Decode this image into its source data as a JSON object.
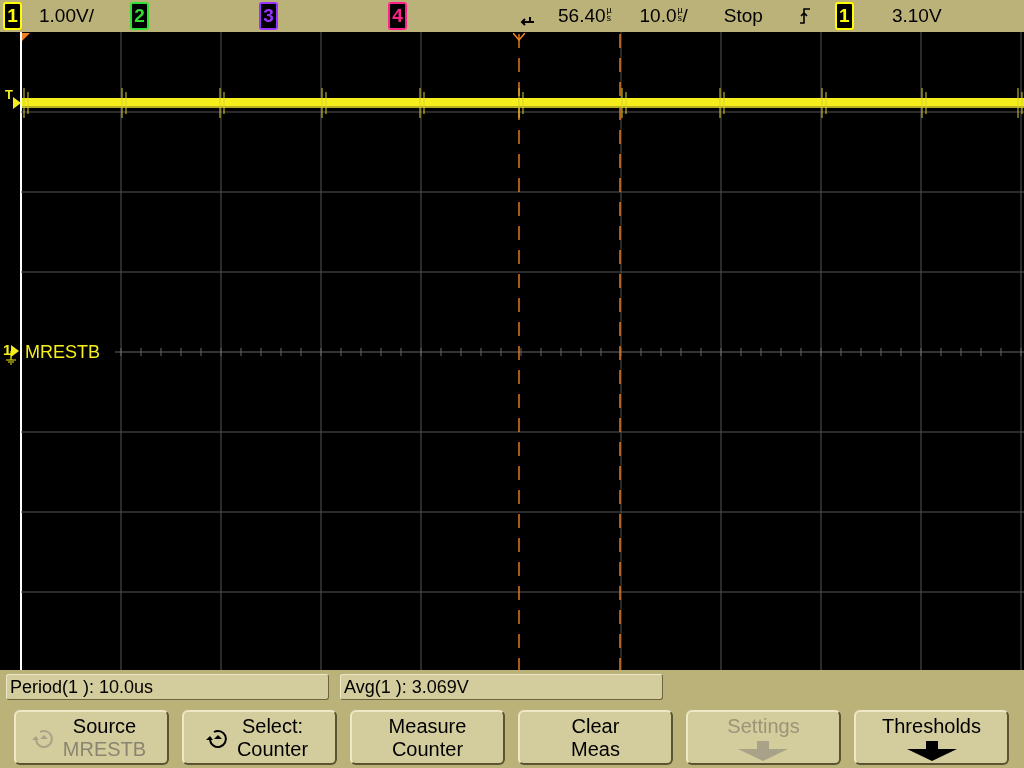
{
  "top_bar": {
    "channels": [
      {
        "number": "1",
        "color": "#ffff00",
        "scale": "1.00V/"
      },
      {
        "number": "2",
        "color": "#33dd33"
      },
      {
        "number": "3",
        "color": "#9933ff"
      },
      {
        "number": "4",
        "color": "#ff2288"
      }
    ],
    "delay": {
      "value": "56.40",
      "unit": "µs"
    },
    "timebase": {
      "value": "10.0",
      "unit": "µs",
      "suffix": "/"
    },
    "run_state": "Stop",
    "trigger": {
      "source": "1",
      "color": "#ffff00",
      "level": "3.10V"
    }
  },
  "display": {
    "trigger_marker": "T",
    "channel_marker": "1",
    "channel_label": "MRESTB"
  },
  "measurements": [
    "Period(1 ): 10.0us",
    "Avg(1 ): 3.069V"
  ],
  "softkeys": [
    {
      "kind": "knob",
      "label": "Source",
      "value": "MRESTB",
      "disabled": true
    },
    {
      "kind": "knob",
      "label": "Select:",
      "value": "Counter",
      "disabled": false
    },
    {
      "kind": "text",
      "label": "Measure",
      "value": "Counter",
      "disabled": false
    },
    {
      "kind": "text",
      "label": "Clear",
      "value": "Meas",
      "disabled": false
    },
    {
      "kind": "menu",
      "label": "Settings",
      "disabled": true
    },
    {
      "kind": "menu",
      "label": "Thresholds",
      "disabled": false
    }
  ]
}
